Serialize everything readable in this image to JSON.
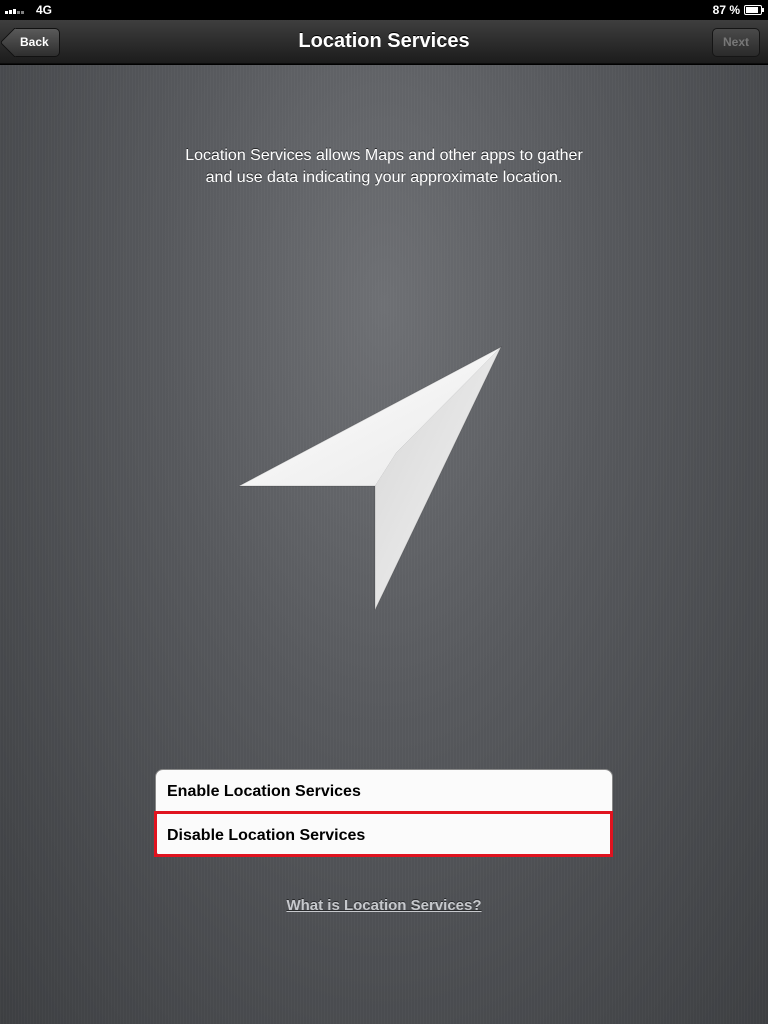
{
  "status_bar": {
    "carrier": "4G",
    "battery_percent": "87 %",
    "battery_level": 0.87
  },
  "nav": {
    "title": "Location Services",
    "back_label": "Back",
    "next_label": "Next"
  },
  "main": {
    "description": "Location Services allows Maps and other apps to gather and use data indicating your approximate location.",
    "icon": "location-arrow-icon",
    "options": [
      {
        "label": "Enable Location Services"
      },
      {
        "label": "Disable Location Services",
        "highlighted": true
      }
    ],
    "help_link": "What is Location Services?"
  },
  "colors": {
    "highlight": "#e0131f",
    "nav_bar": "#2a2a2a",
    "background": "#57595d"
  }
}
